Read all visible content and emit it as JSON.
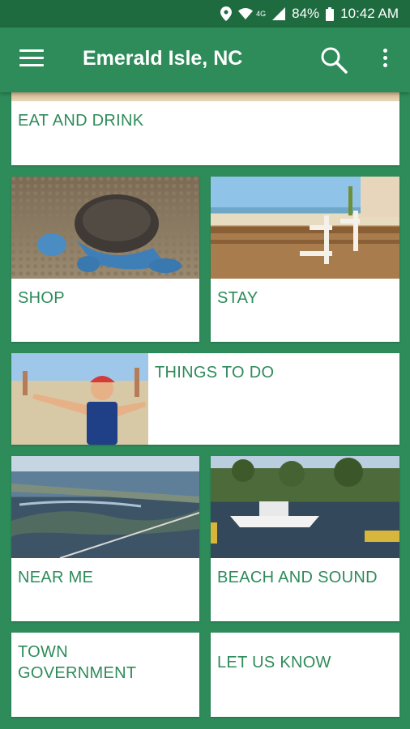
{
  "status": {
    "battery": "84%",
    "time": "10:42 AM",
    "network": "4G"
  },
  "appbar": {
    "title": "Emerald Isle, NC"
  },
  "tiles": {
    "eat": "EAT AND DRINK",
    "shop": "SHOP",
    "stay": "STAY",
    "todo": "THINGS TO DO",
    "near": "NEAR ME",
    "beach": "BEACH AND SOUND",
    "town_line1": "TOWN",
    "town_line2": "GOVERNMENT",
    "letus": "LET US KNOW"
  },
  "colors": {
    "primary": "#2e8b5a",
    "statusbar": "#1e6b40",
    "card": "#ffffff",
    "label": "#2e8b5a"
  },
  "icons": [
    "location-icon",
    "wifi-icon",
    "signal-icon",
    "battery-icon",
    "menu-icon",
    "search-icon",
    "more-vert-icon"
  ]
}
